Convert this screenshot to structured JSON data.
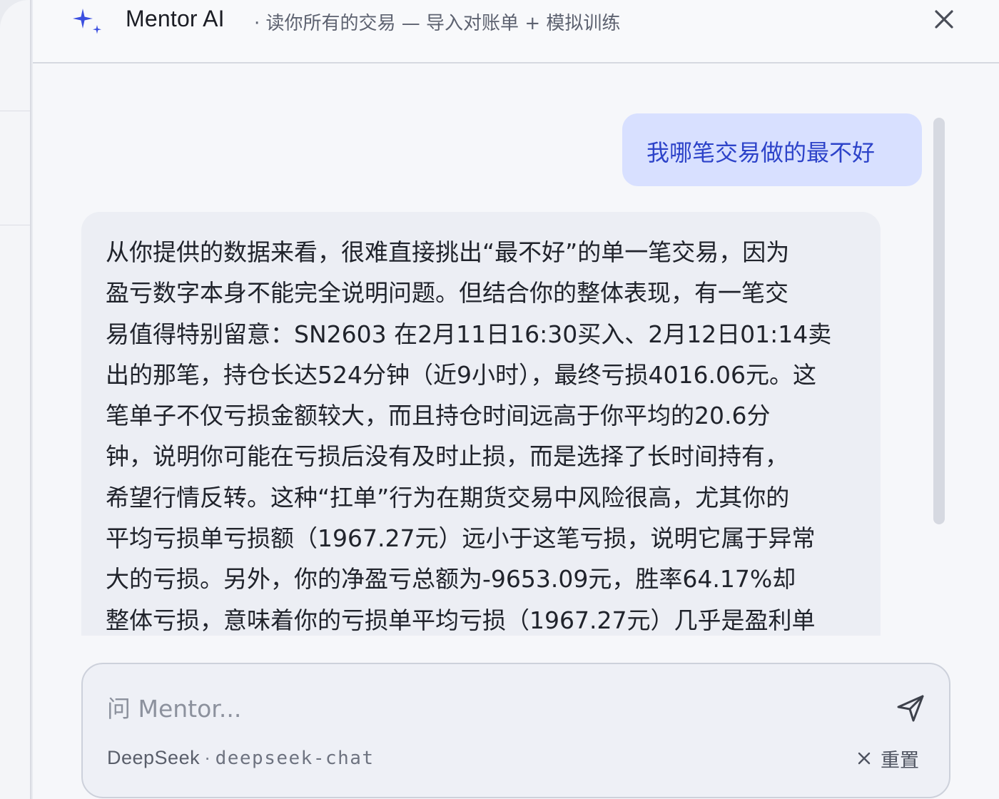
{
  "header": {
    "app_title": "Mentor AI",
    "subtitle": "· 读你所有的交易 — 导入对账单 + 模拟训练",
    "close_icon": "close-icon",
    "logo_icon": "sparkle-icon",
    "accent_color": "#3b4fe0"
  },
  "chat": {
    "messages": [
      {
        "role": "user",
        "text": "我哪笔交易做的最不好"
      },
      {
        "role": "assistant",
        "lines": [
          "从你提供的数据来看，很难直接挑出“最不好”的单一笔交易，因为",
          "盈亏数字本身不能完全说明问题。但结合你的整体表现，有一笔交",
          "易值得特别留意：SN2603 在2月11日16:30买入、2月12日01:14卖",
          "出的那笔，持仓长达524分钟（近9小时），最终亏损4016.06元。这",
          "笔单子不仅亏损金额较大，而且持仓时间远高于你平均的20.6分",
          "钟，说明你可能在亏损后没有及时止损，而是选择了长时间持有，",
          "希望行情反转。这种“扛单”行为在期货交易中风险很高，尤其你的",
          "平均亏损单亏损额（1967.27元）远小于这笔亏损，说明它属于异常",
          "大的亏损。另外，你的净盈亏总额为-9653.09元，胜率64.17%却",
          "整体亏损，意味着你的亏损单平均亏损（1967.27元）几乎是盈利单"
        ]
      }
    ]
  },
  "composer": {
    "placeholder": "问 Mentor...",
    "value": "",
    "provider": "DeepSeek",
    "separator": "·",
    "model": "deepseek-chat",
    "reset_label": "重置",
    "send_icon": "send-icon",
    "reset_icon": "close-icon"
  }
}
